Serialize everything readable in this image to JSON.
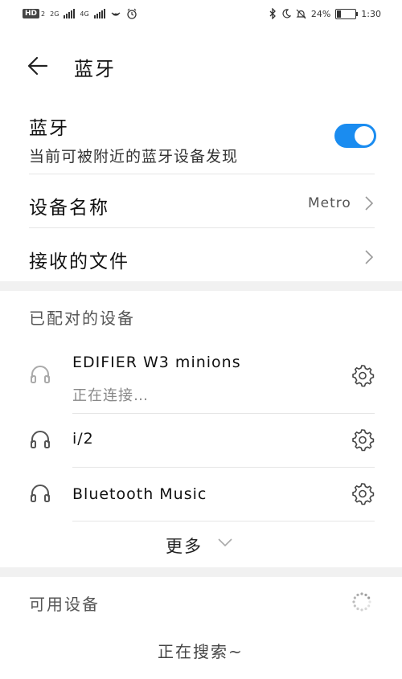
{
  "status_bar": {
    "hd": "HD",
    "hd_sub": "2",
    "net1": "2G",
    "net2": "4G",
    "battery_text": "24%",
    "battery_level": 0.24,
    "time": "1:30"
  },
  "header": {
    "title": "蓝牙"
  },
  "bluetooth": {
    "label": "蓝牙",
    "subtitle": "当前可被附近的蓝牙设备发现",
    "enabled": true,
    "accent": "#1a8cf0"
  },
  "device_name": {
    "label": "设备名称",
    "value": "Metro"
  },
  "received_files": {
    "label": "接收的文件"
  },
  "paired": {
    "section_title": "已配对的设备",
    "devices": [
      {
        "name": "EDIFIER W3 minions",
        "status": "正在连接…",
        "icon": "headphones-icon"
      },
      {
        "name": "i/2",
        "status": "",
        "icon": "headphones-icon"
      },
      {
        "name": "Bluetooth Music",
        "status": "",
        "icon": "headphones-icon"
      }
    ],
    "more_label": "更多"
  },
  "available": {
    "section_title": "可用设备",
    "searching_text": "正在搜索~"
  }
}
